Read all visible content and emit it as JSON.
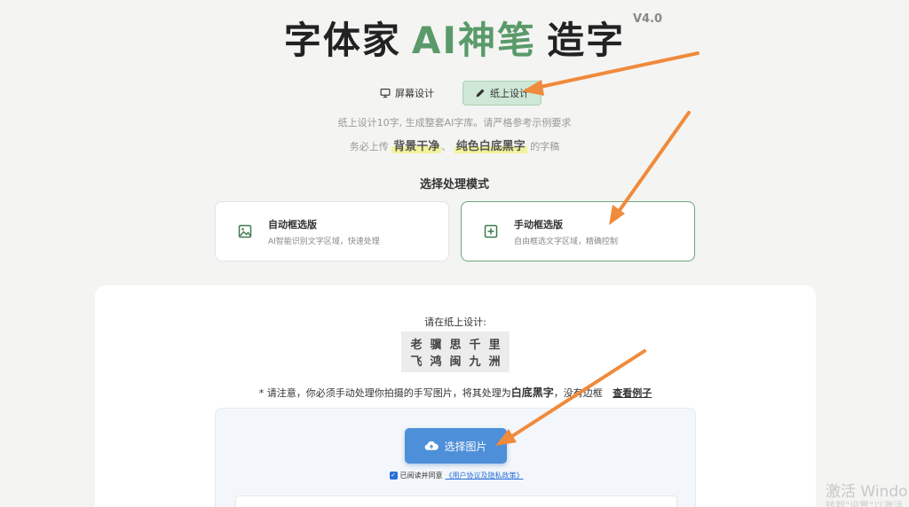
{
  "header": {
    "title_part1": "字体家",
    "title_ai": "AI神笔",
    "title_part2": "造字",
    "version": "V4.0"
  },
  "mode_tabs": [
    {
      "label": "屏幕设计",
      "icon": "monitor-icon",
      "active": false
    },
    {
      "label": "纸上设计",
      "icon": "pencil-icon",
      "active": true
    }
  ],
  "hints": {
    "line1": "纸上设计10字, 生成整套AI字库。请严格参考示例要求",
    "line2_prefix": "务必上传",
    "highlight1": "背景干净",
    "sep": "、",
    "highlight2": "纯色白底黑字",
    "line2_suffix": "的字稿"
  },
  "section_title": "选择处理模式",
  "modes": [
    {
      "title": "自动框选版",
      "desc": "AI智能识别文字区域，快速处理",
      "icon": "image-icon",
      "selected": false
    },
    {
      "title": "手动框选版",
      "desc": "自由框选文字区域，精确控制",
      "icon": "plus-square-icon",
      "selected": true
    }
  ],
  "panel": {
    "label": "请在纸上设计:",
    "chars": [
      "老",
      "骥",
      "思",
      "千",
      "里",
      "飞",
      "鸿",
      "闽",
      "九",
      "洲"
    ],
    "note_prefix": "* 请注意，你必须手动处理你拍摄的手写图片，将其处理为",
    "note_bold": "白底黑字",
    "note_suffix": "，没有边框",
    "example_link": "查看例子",
    "upload_button": "选择图片",
    "agree_text": "已阅读并同意",
    "policy_link": "《用户协议及隐私政策》"
  },
  "os_watermark": {
    "line1": "激活 Windo",
    "line2": "转到\"设置\"以激活"
  },
  "colors": {
    "accent_green": "#5a9a6a",
    "upload_blue": "#4d8fd9",
    "arrow_orange": "#f08a3c"
  }
}
